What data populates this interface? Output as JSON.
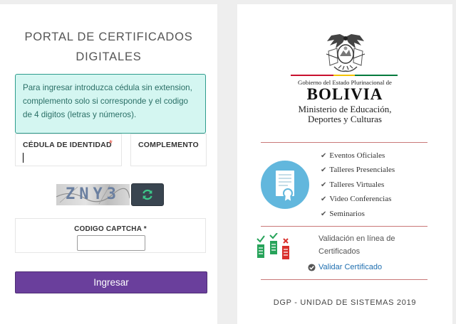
{
  "left": {
    "title_line1": "PORTAL DE CERTIFICADOS",
    "title_line2": "DIGITALES",
    "info_text": "Para ingresar introduzca cédula sin extension, complemento solo si corresponde y el codigo de 4 digitos (letras y números).",
    "ci_label": "CÉDULA DE IDENTIDAD",
    "ci_required": "*",
    "ci_value": "",
    "complement_label": "COMPLEMENTO",
    "captcha_image_text": "ZNY3",
    "captcha_label": "CODIGO CAPTCHA *",
    "captcha_value": "",
    "submit_label": "Ingresar"
  },
  "right": {
    "gov_line": "Gobierno del Estado Plurinacional de",
    "country": "BOLIVIA",
    "ministry_line1": "Ministerio de Educación,",
    "ministry_line2": "Deportes y Culturas",
    "events": [
      "Eventos Oficiales",
      "Talleres Presenciales",
      "Talleres Virtuales",
      "Video Conferencias",
      "Seminarios"
    ],
    "validation_text": "Validación en línea de Certificados",
    "validation_link": "Validar Certificado",
    "footer": "DGP - UNIDAD DE SISTEMAS 2019"
  },
  "colors": {
    "submit_bg": "#6a3f9c",
    "info_bg": "#d4f6f1",
    "info_border": "#2e9c8c",
    "refresh_bg": "#394550",
    "refresh_icon": "#3cc88a",
    "divider": "#c97878",
    "cert_circle": "#62b7dd",
    "link": "#1f6fb0"
  },
  "icons": {
    "refresh": "refresh-icon",
    "certificate": "certificate-icon",
    "check": "check-icon",
    "documents": "documents-icon",
    "check_circle": "check-circle-icon",
    "coat_of_arms": "coat-of-arms-logo"
  }
}
